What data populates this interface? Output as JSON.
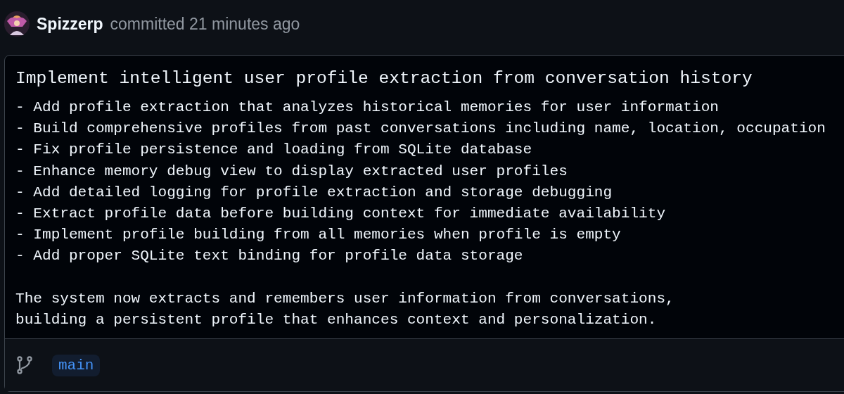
{
  "commit": {
    "author": "Spizzerp",
    "action": "committed 21 minutes ago"
  },
  "message": {
    "title": "Implement intelligent user profile extraction from conversation history",
    "bullets": [
      "- Add profile extraction that analyzes historical memories for user information",
      "- Build comprehensive profiles from past conversations including name, location, occupation",
      "- Fix profile persistence and loading from SQLite database",
      "- Enhance memory debug view to display extracted user profiles",
      "- Add detailed logging for profile extraction and storage debugging",
      "- Extract profile data before building context for immediate availability",
      "- Implement profile building from all memories when profile is empty",
      "- Add proper SQLite text binding for profile data storage"
    ],
    "summary": [
      "The system now extracts and remembers user information from conversations,",
      "building a persistent profile that enhances context and personalization."
    ]
  },
  "branch": "main"
}
